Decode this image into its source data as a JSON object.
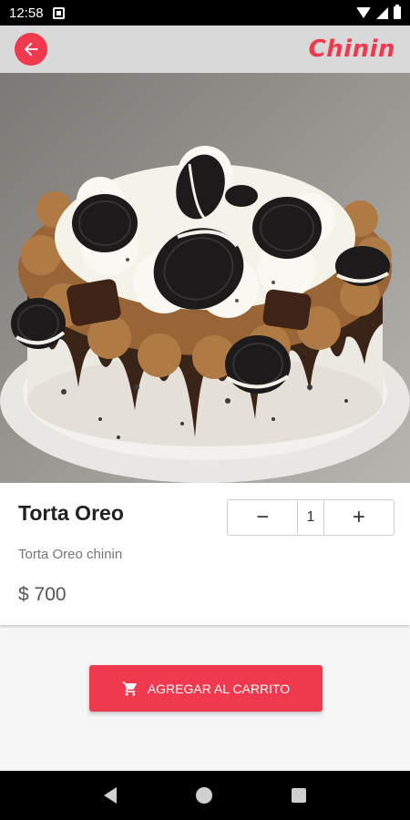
{
  "status_bar": {
    "time": "12:58"
  },
  "app_bar": {
    "brand": "Chinin",
    "brand_color": "#f0384e"
  },
  "product": {
    "image_icon": "cake-photo",
    "name": "Torta Oreo",
    "description": "Torta Oreo chinin",
    "price": "$ 700"
  },
  "quantity": {
    "decrement_label": "−",
    "value": "1",
    "increment_label": "+"
  },
  "add_to_cart": {
    "label": "AGREGAR AL CARRITO",
    "icon": "cart-icon"
  },
  "nav_bar": {
    "icons": [
      "back-icon",
      "home-icon",
      "recents-icon"
    ]
  }
}
